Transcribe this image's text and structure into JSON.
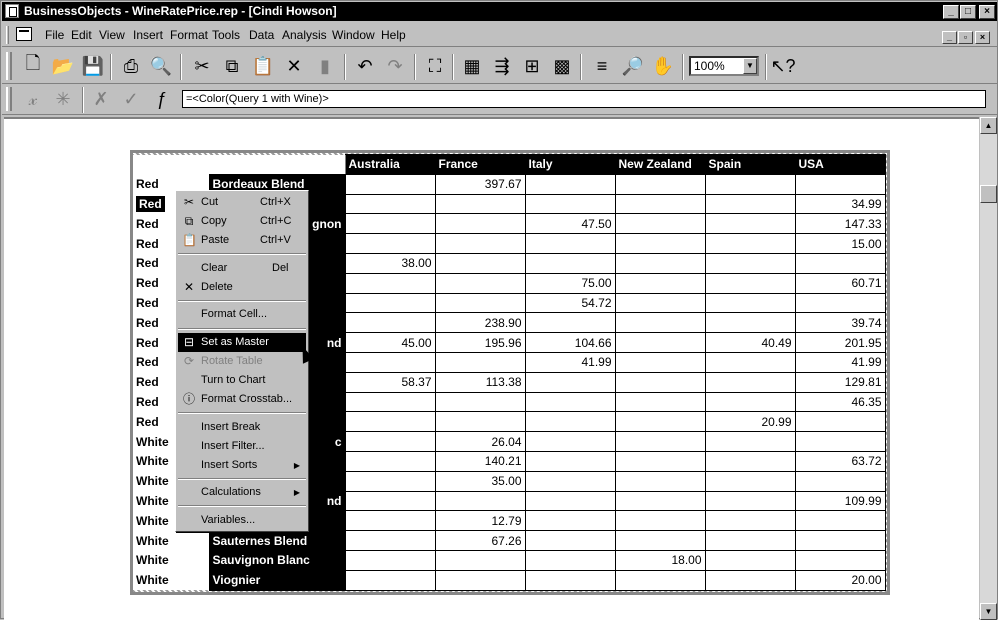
{
  "window": {
    "title": "BusinessObjects - WineRatePrice.rep - [Cindi Howson]"
  },
  "menu": [
    "File",
    "Edit",
    "View",
    "Insert",
    "Format",
    "Tools",
    "Data",
    "Analysis",
    "Window",
    "Help"
  ],
  "toolbar": {
    "zoom": "100%"
  },
  "formula_bar": {
    "value": "=<Color(Query 1 with Wine)>"
  },
  "crosstab": {
    "columns": [
      "Australia",
      "France",
      "Italy",
      "New Zealand",
      "Spain",
      "USA"
    ],
    "rows": [
      {
        "color": "Red",
        "variety": "Bordeaux Blend",
        "values": [
          "",
          "397.67",
          "",
          "",
          "",
          ""
        ]
      },
      {
        "color": "Red",
        "variety": "",
        "values": [
          "",
          "",
          "",
          "",
          "",
          "34.99"
        ]
      },
      {
        "color": "Red",
        "variety": "gnon",
        "values": [
          "",
          "",
          "47.50",
          "",
          "",
          "147.33"
        ]
      },
      {
        "color": "Red",
        "variety": "",
        "values": [
          "",
          "",
          "",
          "",
          "",
          "15.00"
        ]
      },
      {
        "color": "Red",
        "variety": "",
        "values": [
          "38.00",
          "",
          "",
          "",
          "",
          ""
        ]
      },
      {
        "color": "Red",
        "variety": "",
        "values": [
          "",
          "",
          "75.00",
          "",
          "",
          "60.71"
        ]
      },
      {
        "color": "Red",
        "variety": "",
        "values": [
          "",
          "",
          "54.72",
          "",
          "",
          ""
        ]
      },
      {
        "color": "Red",
        "variety": "",
        "values": [
          "",
          "238.90",
          "",
          "",
          "",
          "39.74"
        ]
      },
      {
        "color": "Red",
        "variety": "nd",
        "values": [
          "45.00",
          "195.96",
          "104.66",
          "",
          "40.49",
          "201.95"
        ]
      },
      {
        "color": "Red",
        "variety": "",
        "values": [
          "",
          "",
          "41.99",
          "",
          "",
          "41.99"
        ]
      },
      {
        "color": "Red",
        "variety": "",
        "values": [
          "58.37",
          "113.38",
          "",
          "",
          "",
          "129.81"
        ]
      },
      {
        "color": "Red",
        "variety": "",
        "values": [
          "",
          "",
          "",
          "",
          "",
          "46.35"
        ]
      },
      {
        "color": "Red",
        "variety": "",
        "values": [
          "",
          "",
          "",
          "",
          "20.99",
          ""
        ]
      },
      {
        "color": "White",
        "variety": "c",
        "values": [
          "",
          "26.04",
          "",
          "",
          "",
          ""
        ]
      },
      {
        "color": "White",
        "variety": "",
        "values": [
          "",
          "140.21",
          "",
          "",
          "",
          "63.72"
        ]
      },
      {
        "color": "White",
        "variety": "",
        "values": [
          "",
          "35.00",
          "",
          "",
          "",
          ""
        ]
      },
      {
        "color": "White",
        "variety": "nd",
        "values": [
          "",
          "",
          "",
          "",
          "",
          "109.99"
        ]
      },
      {
        "color": "White",
        "variety": "",
        "values": [
          "",
          "12.79",
          "",
          "",
          "",
          ""
        ]
      },
      {
        "color": "White",
        "variety": "Sauternes Blend",
        "values": [
          "",
          "67.26",
          "",
          "",
          "",
          ""
        ]
      },
      {
        "color": "White",
        "variety": "Sauvignon Blanc",
        "values": [
          "",
          "",
          "",
          "18.00",
          "",
          ""
        ]
      },
      {
        "color": "White",
        "variety": "Viognier",
        "values": [
          "",
          "",
          "",
          "",
          "",
          "20.00"
        ]
      }
    ]
  },
  "context_menu": {
    "cut": {
      "label": "Cut",
      "shortcut": "Ctrl+X"
    },
    "copy": {
      "label": "Copy",
      "shortcut": "Ctrl+C"
    },
    "paste": {
      "label": "Paste",
      "shortcut": "Ctrl+V"
    },
    "clear": {
      "label": "Clear",
      "shortcut": "Del"
    },
    "delete": {
      "label": "Delete"
    },
    "format_cell": {
      "label": "Format Cell..."
    },
    "set_as_master": {
      "label": "Set as Master"
    },
    "rotate_table": {
      "label": "Rotate Table"
    },
    "turn_to_chart": {
      "label": "Turn to Chart"
    },
    "format_crosstab": {
      "label": "Format Crosstab..."
    },
    "insert_break": {
      "label": "Insert Break"
    },
    "insert_filter": {
      "label": "Insert Filter..."
    },
    "insert_sorts": {
      "label": "Insert Sorts"
    },
    "calculations": {
      "label": "Calculations"
    },
    "variables": {
      "label": "Variables..."
    }
  }
}
